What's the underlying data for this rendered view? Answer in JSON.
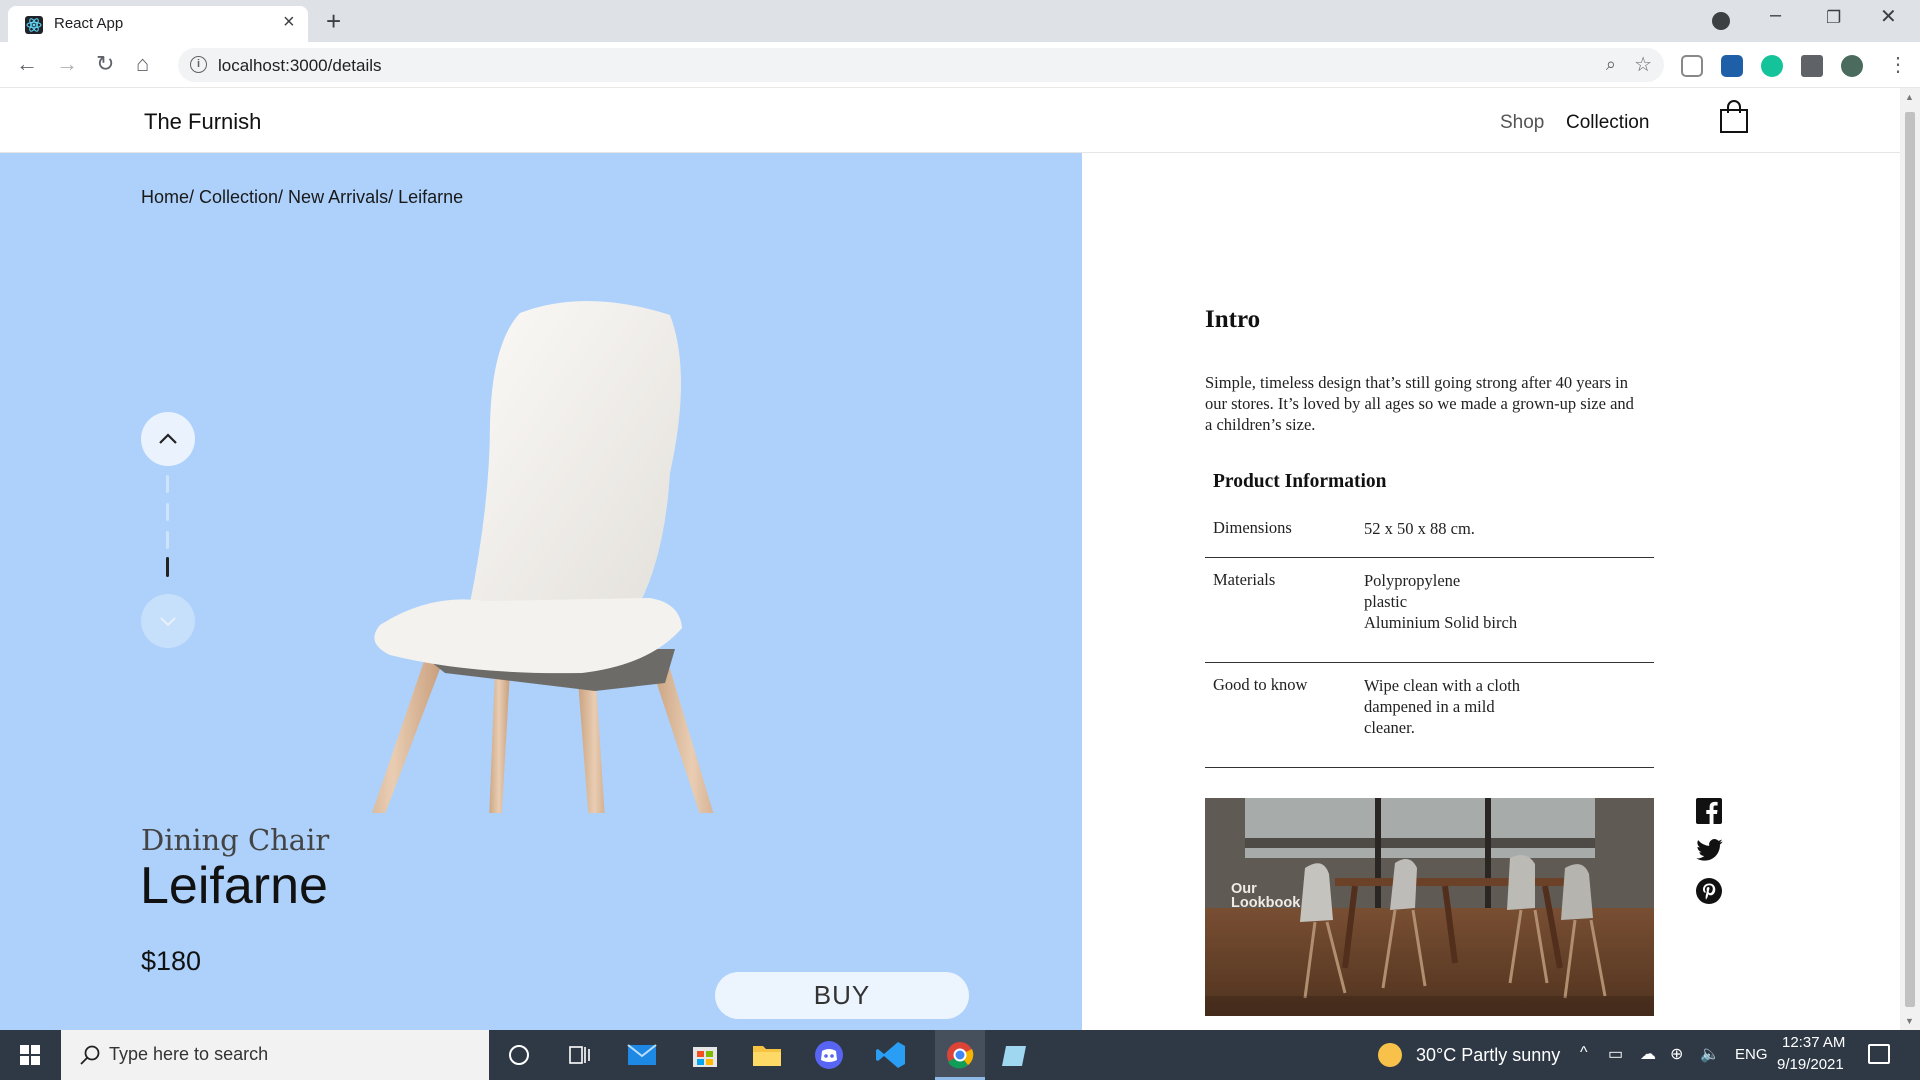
{
  "browser": {
    "tab_title": "React App",
    "url": "localhost:3000/details"
  },
  "site": {
    "brand": "The Furnish",
    "nav": {
      "shop": "Shop",
      "collection": "Collection"
    }
  },
  "product": {
    "breadcrumb": "Home/ Collection/ New Arrivals/ Leifarne",
    "category": "Dining Chair",
    "name": "Leifarne",
    "price": "$180",
    "buy_label": "BUY",
    "slider_active_index": 4,
    "slider_count": 4
  },
  "details": {
    "intro_title": "Intro",
    "intro_text": "Simple, timeless design that’s still going strong after 40 years in our stores. It’s loved by all ages so we made a grown-up size and a children’s size.",
    "info_title": "Product Information",
    "rows": [
      {
        "label": "Dimensions",
        "value": "52 x 50 x 88 cm."
      },
      {
        "label": "Materials",
        "value": "Polypropylene\nplastic\nAluminium Solid birch"
      },
      {
        "label": "Good to know",
        "value": "Wipe clean with a cloth\ndampened in a mild\ncleaner."
      }
    ],
    "lookbook_label": "Our\nLookbook"
  },
  "social": [
    "facebook-icon",
    "twitter-icon",
    "pinterest-icon"
  ],
  "taskbar": {
    "search_placeholder": "Type here to search",
    "weather": "30°C  Partly sunny",
    "language": "ENG",
    "time": "12:37 AM",
    "date": "9/19/2021"
  },
  "colors": {
    "hero_bg": "#add1fb",
    "buy_button_bg": "#ecf4fe",
    "taskbar_bg": "#2f3946"
  }
}
